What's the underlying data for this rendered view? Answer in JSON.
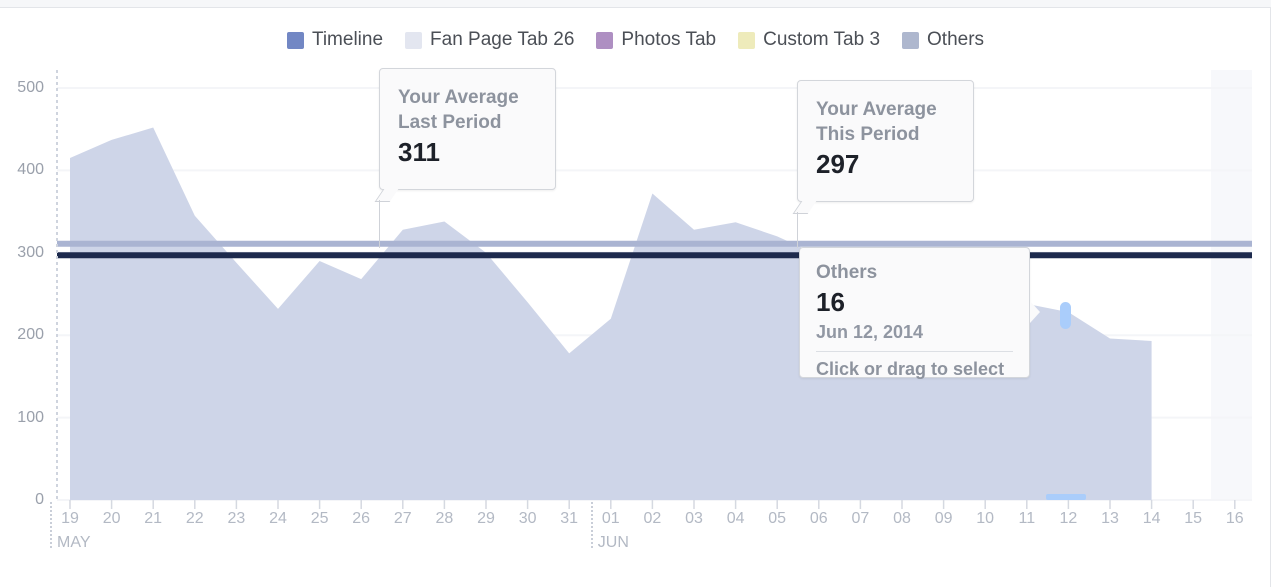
{
  "legend": {
    "items": [
      {
        "label": "Timeline",
        "color": "#7287c4",
        "icon": "legend-swatch-icon"
      },
      {
        "label": "Fan Page Tab 26",
        "color": "#e3e6f0",
        "icon": "legend-swatch-icon"
      },
      {
        "label": "Photos Tab",
        "color": "#ae8fc2",
        "icon": "legend-swatch-icon"
      },
      {
        "label": "Custom Tab 3",
        "color": "#eeebbb",
        "icon": "legend-swatch-icon"
      },
      {
        "label": "Others",
        "color": "#aeb7ce",
        "icon": "legend-swatch-icon"
      }
    ]
  },
  "axes": {
    "y_ticks": [
      "500",
      "400",
      "300",
      "200",
      "100",
      "0"
    ],
    "x_ticks": [
      "19",
      "20",
      "21",
      "22",
      "23",
      "24",
      "25",
      "26",
      "27",
      "28",
      "29",
      "30",
      "31",
      "01",
      "02",
      "03",
      "04",
      "05",
      "06",
      "07",
      "08",
      "09",
      "10",
      "11",
      "12",
      "13",
      "14",
      "15",
      "16"
    ],
    "months": [
      {
        "label": "MAY",
        "tick_index": 0
      },
      {
        "label": "JUN",
        "tick_index": 13
      }
    ]
  },
  "callouts": {
    "last_period": {
      "title": "Your Average\nLast Period",
      "value": "311"
    },
    "this_period": {
      "title": "Your Average\nThis Period",
      "value": "297"
    },
    "point": {
      "series": "Others",
      "value": "16",
      "date": "Jun 12, 2014",
      "hint": "Click or drag to select"
    }
  },
  "colors": {
    "area_fill": "#ced5e8",
    "avg_last_line": "#aab4d2",
    "avg_this_line": "#1d2a4d",
    "grid": "#f4f5f8",
    "hover_marker": "#aacdfb",
    "axis_text": "#b3b9c4",
    "y_axis_text": "#9aa0ab"
  },
  "chart_data": {
    "type": "area",
    "title": "",
    "xlabel": "",
    "ylabel": "",
    "ylim": [
      0,
      500
    ],
    "grid": true,
    "legend_position": "top-center",
    "categories": [
      "May 19",
      "May 20",
      "May 21",
      "May 22",
      "May 23",
      "May 24",
      "May 25",
      "May 26",
      "May 27",
      "May 28",
      "May 29",
      "May 30",
      "May 31",
      "Jun 01",
      "Jun 02",
      "Jun 03",
      "Jun 04",
      "Jun 05",
      "Jun 06",
      "Jun 07",
      "Jun 08",
      "Jun 09",
      "Jun 10",
      "Jun 11",
      "Jun 12",
      "Jun 13",
      "Jun 14"
    ],
    "series": [
      {
        "name": "Fan Page Tab 26",
        "color": "#ced5e8",
        "values": [
          415,
          437,
          452,
          345,
          288,
          232,
          290,
          268,
          328,
          338,
          300,
          240,
          178,
          220,
          372,
          328,
          337,
          320,
          297,
          280,
          268,
          258,
          250,
          238,
          228,
          196,
          193
        ]
      }
    ],
    "reference_lines": [
      {
        "name": "Your Average Last Period",
        "value": 311,
        "color": "#aab4d2"
      },
      {
        "name": "Your Average This Period",
        "value": 297,
        "color": "#1d2a4d"
      }
    ],
    "highlighted_point": {
      "x": "Jun 12",
      "series": "Others",
      "value": 16
    }
  }
}
